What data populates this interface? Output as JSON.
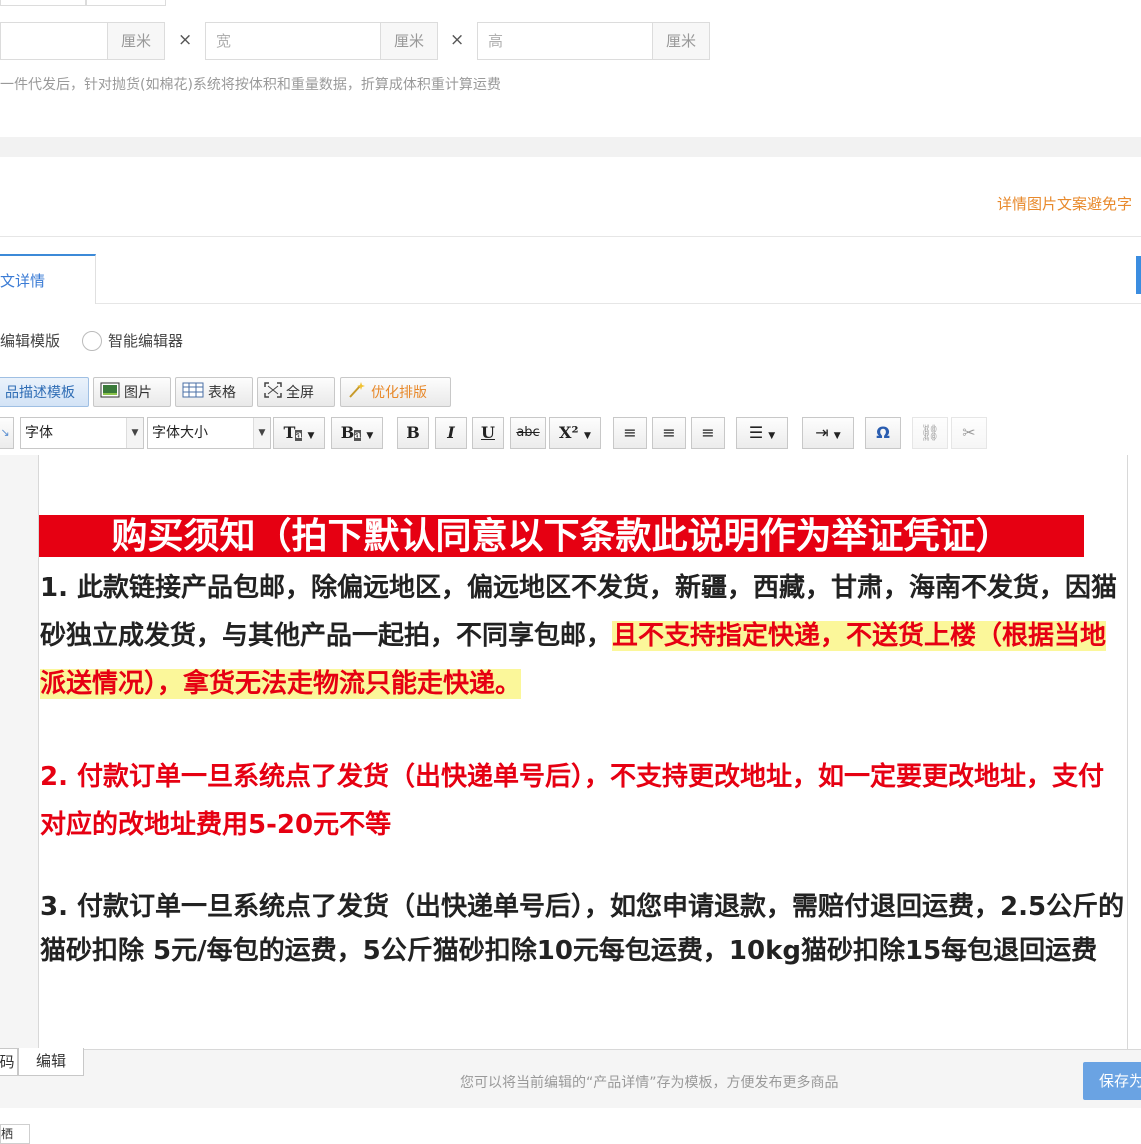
{
  "dimensions": {
    "length": {
      "placeholder": "",
      "unit": "厘米"
    },
    "width": {
      "placeholder": "宽",
      "unit": "厘米"
    },
    "height": {
      "placeholder": "高",
      "unit": "厘米"
    },
    "times": "×",
    "hint": "一件代发后，针对抛货(如棉花)系统将按体积和重量数据，折算成体积重计算运费"
  },
  "detail_note": "详情图片文案避免字",
  "tab": {
    "label": "文详情"
  },
  "template_options": {
    "option1": "编辑模版",
    "option2": "智能编辑器"
  },
  "toolbar1": {
    "desc_template": "品描述模板",
    "image": "图片",
    "table": "表格",
    "fullscreen": "全屏",
    "optimize": "优化排版"
  },
  "toolbar2": {
    "font": "字体",
    "font_size": "字体大小",
    "bold": "B",
    "italic": "I",
    "underline": "U",
    "strike": "abc",
    "superscript": "X²",
    "omega": "Ω"
  },
  "content": {
    "title": "购买须知（拍下默认同意以下条款此说明作为举证凭证）",
    "p1_normal": "1. 此款链接产品包邮，除偏远地区，偏远地区不发货，新疆，西藏，甘肃，海南不发货，因猫砂独立成发货，与其他产品一起拍，不同享包邮，",
    "p1_highlight": "且不支持指定快递，不送货上楼（根据当地派送情况），拿货无法走物流只能走快递。",
    "p2": "2. 付款订单一旦系统点了发货（出快递单号后），不支持更改地址，如一定要更改地址，支付对应的改地址费用5-20元不等",
    "p3": "3. 付款订单一旦系统点了发货（出快递单号后），如您申请退款，需赔付退回运费，2.5公斤的猫砂扣除 5元/每包的运费，5公斤猫砂扣除10元每包运费，10kg猫砂扣除15每包退回运费"
  },
  "bottom": {
    "tab_code": "码",
    "tab_edit": "编辑",
    "note": "您可以将当前编辑的“产品详情”存为模板，方便发布更多商品",
    "save": "保存为",
    "stub": "栖"
  },
  "colors": {
    "accent": "#3c8ad8",
    "red": "#e60012",
    "highlight": "#fbf79a",
    "orange": "#e8892b"
  }
}
